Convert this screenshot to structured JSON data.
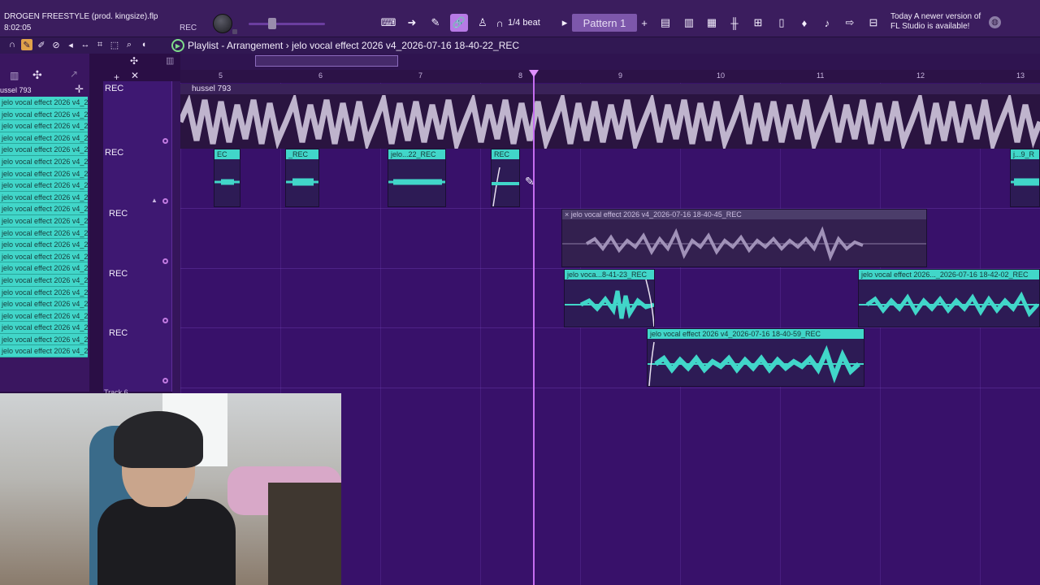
{
  "toolbar": {
    "project_title": "DROGEN FREESTYLE (prod. kingsize).flp",
    "project_time": "8:02:05",
    "rec_tag": "REC",
    "snap_label": "1/4 beat",
    "pattern_label": "Pattern 1",
    "notification_line1": "Today  A newer version of",
    "notification_line2": "FL Studio is available!"
  },
  "playlist": {
    "title": "Playlist - Arrangement",
    "breadcrumb_clip": "jelo vocal effect 2026 v4_2026-07-16 18-40-22_REC"
  },
  "picker": {
    "header": "ussel 793",
    "items": [
      "jelo vocal effect 2026 v4_2",
      "jelo vocal effect 2026 v4_2",
      "jelo vocal effect 2026 v4_2",
      "jelo vocal effect 2026 v4_2",
      "jelo vocal effect 2026 v4_2",
      "jelo vocal effect 2026 v4_2",
      "jelo vocal effect 2026 v4_2",
      "jelo vocal effect 2026 v4_2",
      "jelo vocal effect 2026 v4_2",
      "jelo vocal effect 2026 v4_2",
      "jelo vocal effect 2026 v4_2",
      "jelo vocal effect 2026 v4_2",
      "jelo vocal effect 2026 v4_2",
      "jelo vocal effect 2026 v4_2",
      "jelo vocal effect 2026 v4_2",
      "jelo vocal effect 2026 v4_2",
      "jelo vocal effect 2026 v4_2",
      "jelo vocal effect 2026 v4_2",
      "jelo vocal effect 2026 v4_2",
      "jelo vocal effect 2026 v4_2",
      "jelo vocal effect 2026 v4_2",
      "jelo vocal effect 2026 v4_2"
    ]
  },
  "tracks": {
    "labels": [
      "REC",
      "REC",
      "REC",
      "REC",
      "REC"
    ],
    "cut_label": "Track 6"
  },
  "ruler": {
    "bars": [
      "5",
      "6",
      "7",
      "8",
      "9",
      "10",
      "11",
      "12",
      "13"
    ]
  },
  "clips": {
    "hussel_name": "hussel 793",
    "short1": "EC",
    "short2": "_REC",
    "short3": "jelo...22_REC",
    "short4": "REC",
    "short5": "j...9_R",
    "grey_clip": "jelo vocal effect 2026 v4_2026-07-16 18-40-45_REC",
    "clip_a": "jelo voca...8-41-23_REC",
    "clip_b": "jelo vocal effect 2026..._2026-07-16 18-42-02_REC",
    "clip_c": "jelo vocal effect 2026 v4_2026-07-16 18-40-59_REC"
  },
  "colors": {
    "accent": "#c56df0",
    "clip": "#41d6c9",
    "background": "#38116a"
  }
}
